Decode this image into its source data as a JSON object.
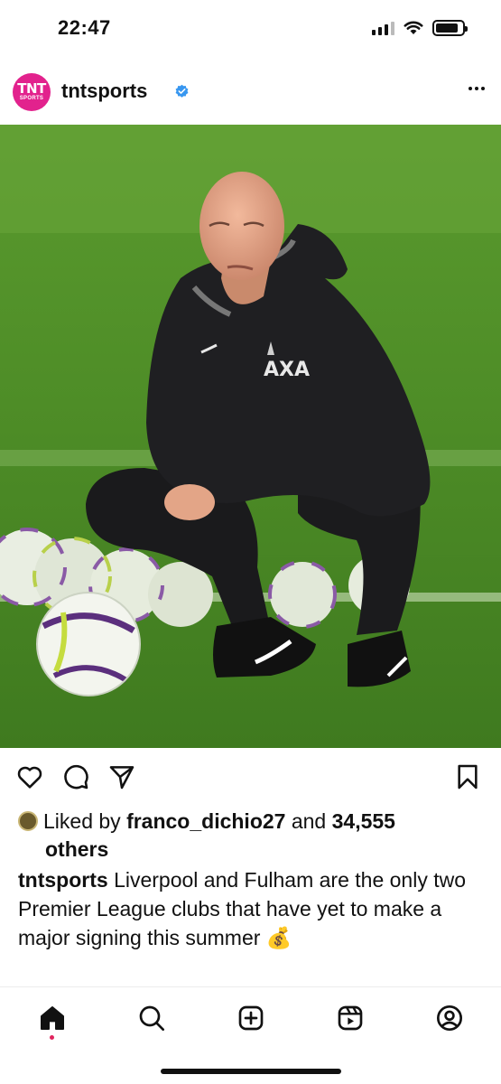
{
  "status_bar": {
    "time": "22:47",
    "icons": [
      "cellular-signal-icon",
      "wifi-icon",
      "battery-icon"
    ],
    "battery_level": 0.85
  },
  "post": {
    "username": "tntsports",
    "verified": true,
    "avatar": {
      "line1": "TNT",
      "line2": "SPORTS",
      "color": "#e2228d"
    },
    "more_icon": "more-horizontal-icon",
    "image_alt": "Liverpool head coach crouching on training pitch beside footballs",
    "actions": [
      "heart-icon",
      "comment-icon",
      "share-icon",
      "bookmark-icon"
    ],
    "likes": {
      "prefix": "Liked by",
      "user": "franco_dichio27",
      "connector": "and",
      "count": "34,555",
      "suffix": "others"
    },
    "caption": {
      "username": "tntsports",
      "text": "Liverpool and Fulham are the only two Premier League clubs that have yet to make a major signing this summer",
      "emoji": "💰"
    }
  },
  "bottom_nav": {
    "items": [
      "home-icon",
      "search-icon",
      "create-icon",
      "reels-icon",
      "profile-icon"
    ],
    "active": "home-icon"
  },
  "colors": {
    "accent": "#e2228d",
    "verified_blue": "#3897f0",
    "notification_dot": "#e0245e"
  }
}
